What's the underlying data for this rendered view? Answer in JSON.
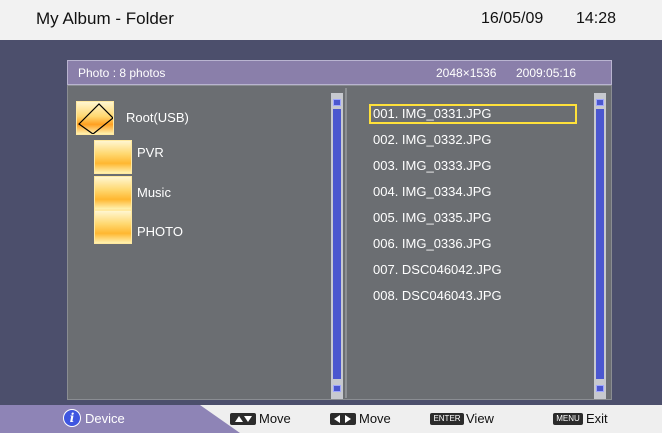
{
  "header": {
    "title": "My Album - Folder",
    "date": "16/05/09",
    "time": "14:28"
  },
  "info_bar": {
    "photo_count": "Photo : 8 photos",
    "resolution": "2048×1536",
    "photo_date": "2009:05:16"
  },
  "tree": [
    {
      "label": "Root(USB)",
      "icon": "open-folder-icon"
    },
    {
      "label": "PVR",
      "icon": "folder-icon"
    },
    {
      "label": "Music",
      "icon": "folder-icon"
    },
    {
      "label": "PHOTO",
      "icon": "folder-icon"
    }
  ],
  "files": [
    {
      "label": "001.  IMG_0331.JPG",
      "selected": true
    },
    {
      "label": "002.  IMG_0332.JPG"
    },
    {
      "label": "003.  IMG_0333.JPG"
    },
    {
      "label": "004.  IMG_0334.JPG"
    },
    {
      "label": "005.  IMG_0335.JPG"
    },
    {
      "label": "006.  IMG_0336.JPG"
    },
    {
      "label": "007.  DSC046042.JPG"
    },
    {
      "label": "008.  DSC046043.JPG"
    }
  ],
  "footer": {
    "device_label": "Device",
    "hints": [
      {
        "key_icon": "up-down-arrows-icon",
        "label": "Move"
      },
      {
        "key_icon": "left-right-arrows-icon",
        "label": "Move"
      },
      {
        "key_text": "ENTER",
        "label": "View"
      },
      {
        "key_text": "MENU",
        "label": "Exit"
      }
    ]
  },
  "colors": {
    "background": "#4c4f6c",
    "panel": "#6b6e72",
    "header_bar": "#8a7faa",
    "selection": "#ffe13a",
    "scroll_thumb": "#4b57cf"
  }
}
